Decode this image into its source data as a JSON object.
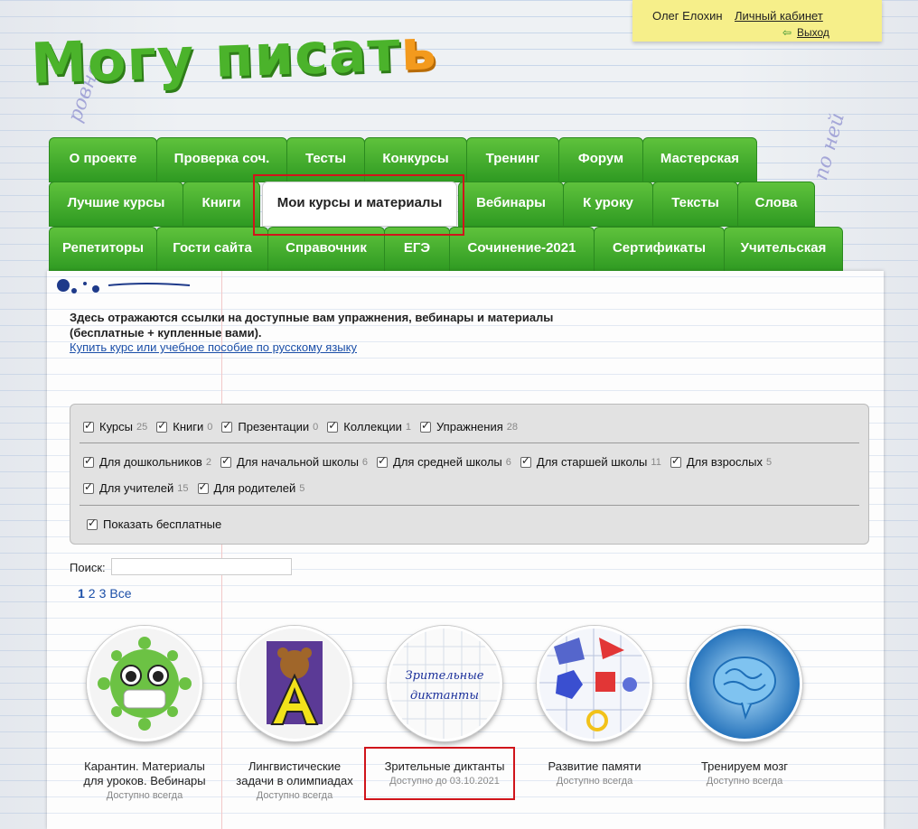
{
  "logo": {
    "main": "Могу писат",
    "accent": "ь"
  },
  "user": {
    "name": "Олег Елохин",
    "cabinet": "Личный кабинет",
    "logout": "Выход"
  },
  "tabs": {
    "row1": [
      "О проекте",
      "Проверка соч.",
      "Тесты",
      "Конкурсы",
      "Тренинг",
      "Форум",
      "Мастерская"
    ],
    "row2": [
      "Лучшие курсы",
      "Книги",
      "Мои курсы и материалы",
      "Вебинары",
      "К уроку",
      "Тексты",
      "Слова"
    ],
    "row3": [
      "Репетиторы",
      "Гости сайта",
      "Справочник",
      "ЕГЭ",
      "Сочинение-2021",
      "Сертификаты",
      "Учительская"
    ],
    "active": "Мои курсы и материалы"
  },
  "intro": {
    "line1": "Здесь отражаются ссылки на доступные вам упражнения, вебинары и материалы",
    "line2": "(бесплатные + купленные вами).",
    "link": "Купить курс или учебное пособие по русскому языку"
  },
  "filters": {
    "types": [
      {
        "label": "Курсы",
        "count": "25"
      },
      {
        "label": "Книги",
        "count": "0"
      },
      {
        "label": "Презентации",
        "count": "0"
      },
      {
        "label": "Коллекции",
        "count": "1"
      },
      {
        "label": "Упражнения",
        "count": "28"
      }
    ],
    "audiences_row1": [
      {
        "label": "Для дошкольников",
        "count": "2"
      },
      {
        "label": "Для начальной школы",
        "count": "6"
      },
      {
        "label": "Для средней школы",
        "count": "6"
      },
      {
        "label": "Для старшей школы",
        "count": "11"
      },
      {
        "label": "Для взрослых",
        "count": "5"
      }
    ],
    "audiences_row2": [
      {
        "label": "Для учителей",
        "count": "15"
      },
      {
        "label": "Для родителей",
        "count": "5"
      }
    ],
    "show_free": "Показать бесплатные"
  },
  "search": {
    "label": "Поиск:",
    "value": ""
  },
  "pagination": {
    "pages": [
      "1",
      "2",
      "3"
    ],
    "current": "1",
    "all": "Все"
  },
  "courses": [
    {
      "title1": "Карантин. Материалы",
      "title2": "для уроков. Вебинары",
      "avail": "Доступно всегда"
    },
    {
      "title1": "Лингвистические",
      "title2": "задачи в олимпиадах",
      "avail": "Доступно всегда"
    },
    {
      "title1": "Зрительные диктанты",
      "title2": "",
      "avail": "Доступно до 03.10.2021",
      "image_text1": "Зрительные",
      "image_text2": "диктанты"
    },
    {
      "title1": "Развитие памяти",
      "title2": "",
      "avail": "Доступно всегда"
    },
    {
      "title1": "Тренируем мозг",
      "title2": "",
      "avail": "Доступно всегда"
    }
  ],
  "colors": {
    "tab_green": "#3fae2c",
    "link_blue": "#1a4ea8",
    "highlight_red": "#d0141b",
    "note_yellow": "#f6ef8a"
  }
}
